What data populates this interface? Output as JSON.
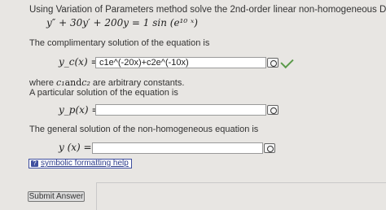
{
  "question": {
    "intro": "Using Variation of Parameters method solve the 2nd-order linear non-homogeneous DE,",
    "equation": "y″ + 30y′ + 200y = 1 sin (e¹⁰ ˣ)"
  },
  "complementary": {
    "prompt": "The complimentary solution of the equation is",
    "label": "y_c(x) =",
    "value": "c1e^(-20x)+c2e^(-10x)",
    "note_prefix": "where ",
    "note_c1": "c₁",
    "note_and": "and",
    "note_c2": "c₂",
    "note_suffix": " are arbitrary constants.",
    "status_color": "#5a9a4a"
  },
  "particular": {
    "prompt": "A particular solution of the equation is",
    "label": "y_p(x) =",
    "value": ""
  },
  "general": {
    "prompt": "The general solution of the non-homogeneous equation is",
    "label": "y (x) =",
    "value": ""
  },
  "help": {
    "icon": "?",
    "label": "symbolic formatting help"
  },
  "submit": {
    "label": "Submit Answer"
  },
  "icons": {
    "preview": "eye-preview-icon",
    "check": "checkmark-icon",
    "help": "question-icon"
  }
}
